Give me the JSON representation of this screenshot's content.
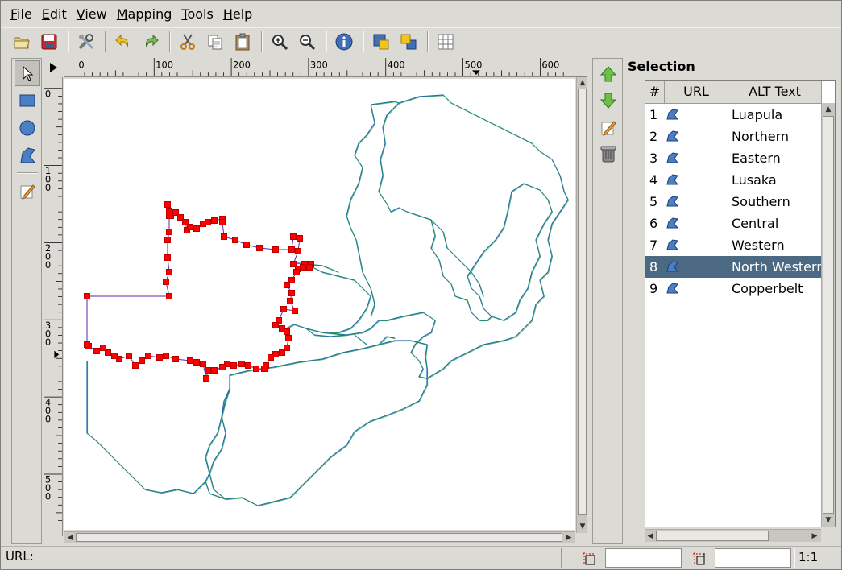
{
  "menu": {
    "items": [
      {
        "mnemonic": "F",
        "rest": "ile"
      },
      {
        "mnemonic": "E",
        "rest": "dit"
      },
      {
        "mnemonic": "V",
        "rest": "iew"
      },
      {
        "mnemonic": "M",
        "rest": "apping"
      },
      {
        "mnemonic": "T",
        "rest": "ools"
      },
      {
        "mnemonic": "H",
        "rest": "elp"
      }
    ]
  },
  "toolbar": {
    "icons": [
      "open-icon",
      "save-icon",
      "preferences-icon",
      "undo-icon",
      "redo-icon",
      "cut-icon",
      "copy-icon",
      "paste-icon",
      "zoom-in-icon",
      "zoom-out-icon",
      "info-icon",
      "move-to-front-icon",
      "send-to-back-icon",
      "grid-icon"
    ]
  },
  "tools": {
    "icons": [
      "arrow-icon",
      "rectangle-icon",
      "circle-icon",
      "polygon-icon",
      "edit-icon"
    ],
    "active": "arrow-icon"
  },
  "rulers": {
    "horizontal_labels": [
      "0",
      "100",
      "200",
      "300",
      "400",
      "500",
      "600"
    ],
    "vertical_labels": [
      "0",
      "100",
      "200",
      "300",
      "400",
      "500"
    ]
  },
  "selection": {
    "title": "Selection",
    "columns": {
      "num": "#",
      "url": "URL",
      "alt": "ALT Text"
    },
    "rows": [
      {
        "num": "1",
        "alt": "Luapula"
      },
      {
        "num": "2",
        "alt": "Northern"
      },
      {
        "num": "3",
        "alt": "Eastern"
      },
      {
        "num": "4",
        "alt": "Lusaka"
      },
      {
        "num": "5",
        "alt": "Southern"
      },
      {
        "num": "6",
        "alt": "Central"
      },
      {
        "num": "7",
        "alt": "Western"
      },
      {
        "num": "8",
        "alt": "North Western"
      },
      {
        "num": "9",
        "alt": "Copperbelt"
      }
    ],
    "selected_row": "8"
  },
  "status": {
    "url_label": "URL:",
    "zoom": "1:1"
  },
  "colors": {
    "selection_highlight": "#4b6983",
    "region_outline": "#1f6fa6",
    "handle_red": "#ff0000",
    "selected_outline": "#5a2aa8"
  }
}
